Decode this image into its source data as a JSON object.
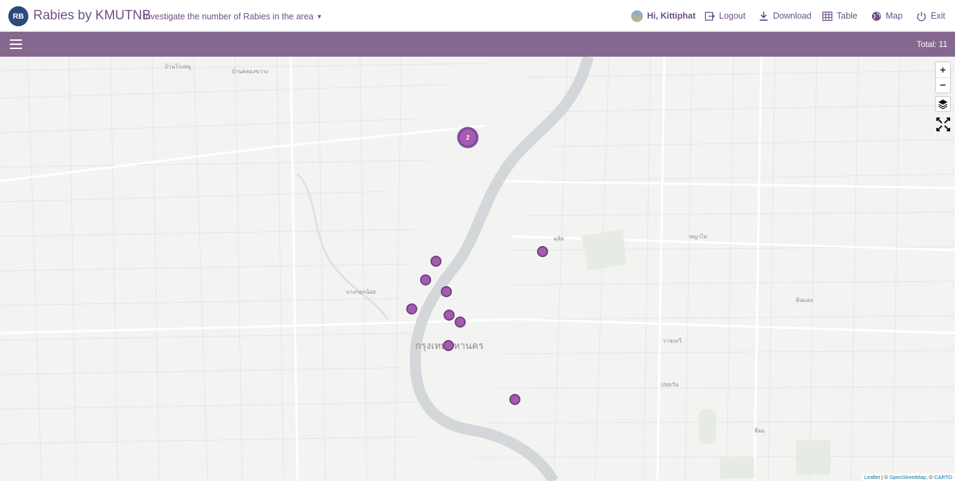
{
  "header": {
    "logo_initials": "RB",
    "title": "Rabies by KMUTNB",
    "subtitle": "Investigate the number of Rabies in the area",
    "user_greeting": "Hi, Kittiphat",
    "logout_label": "Logout",
    "download_label": "Download",
    "table_label": "Table",
    "map_label": "Map",
    "exit_label": "Exit"
  },
  "toolbar": {
    "total_text": "Total: 11"
  },
  "map": {
    "city_label": "กรุงเทพมหานคร",
    "cluster_count": "2",
    "zoom_in_label": "+",
    "zoom_out_label": "−",
    "attribution_leaflet": "Leaflet",
    "attribution_sep": " | © ",
    "attribution_osm": "OpenStreetMap",
    "attribution_sep2": ", © ",
    "attribution_carto": "CARTO",
    "place_labels": [
      "บ้านโรงหมู",
      "บ้านคลองขวาง",
      "บางกอกน้อย",
      "ดุสิต",
      "พญาไท",
      "ราชเทวี",
      "ปทุมวัน",
      "สีลม",
      "ดินแดง"
    ]
  },
  "colors": {
    "brand": "#6e4f86",
    "subbar": "#85688f",
    "marker_fill": "#a55bb0",
    "marker_border": "#6e3f83"
  },
  "icons": {
    "logout": "logout-icon",
    "download": "download-icon",
    "table": "table-icon",
    "map": "globe-icon",
    "exit": "power-icon",
    "menu": "hamburger-icon",
    "layers": "layers-icon",
    "fit": "fit-bounds-icon"
  }
}
